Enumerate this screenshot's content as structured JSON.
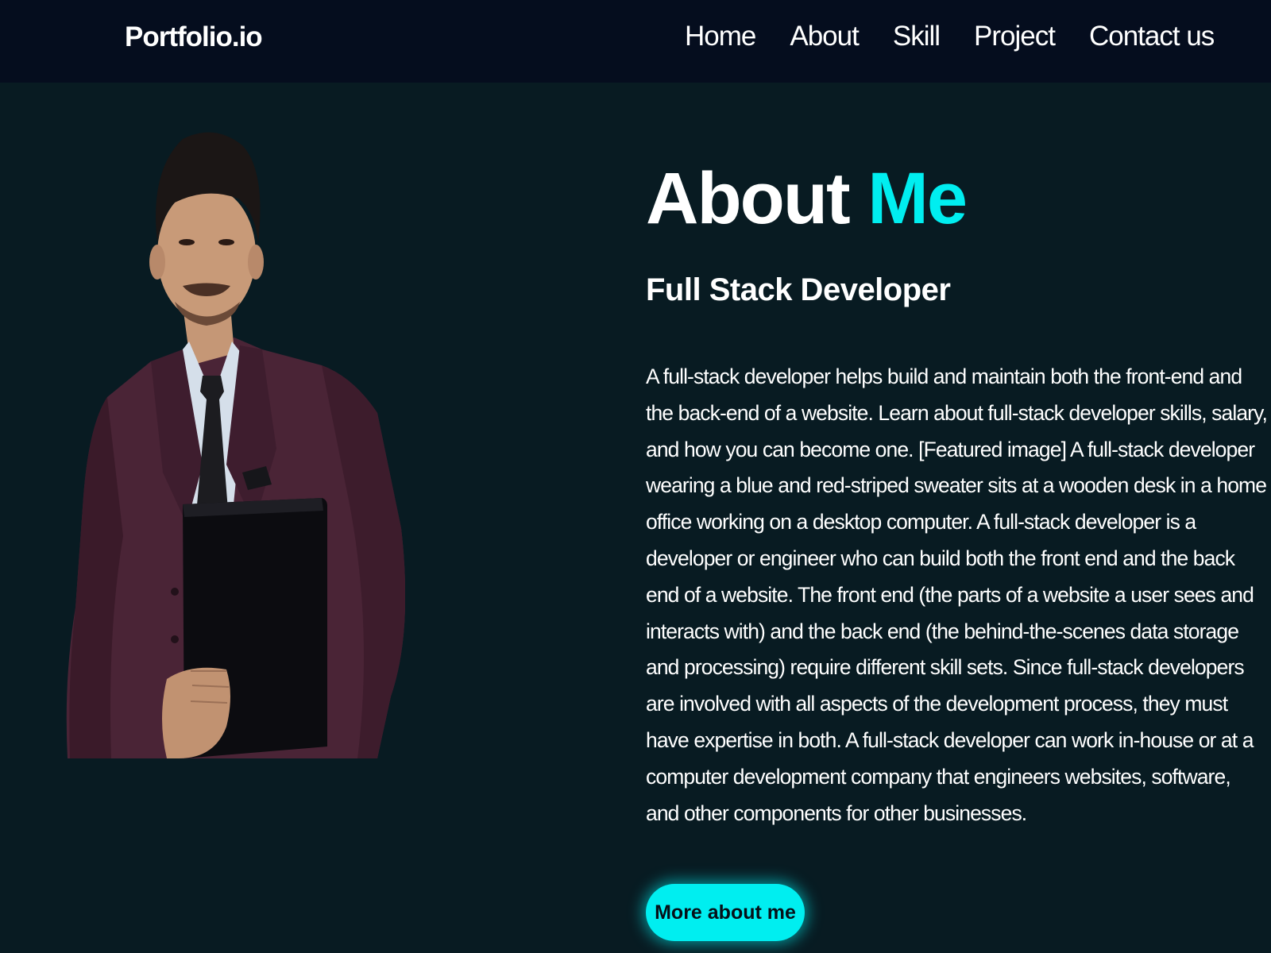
{
  "navbar": {
    "logo": "Portfolio.io",
    "links": [
      "Home",
      "About",
      "Skill",
      "Project",
      "Contact us"
    ]
  },
  "about": {
    "title_part1": "About ",
    "title_part2": "Me",
    "subtitle": "Full Stack Developer",
    "bio": "A full-stack developer helps build and maintain both the front-end and the back-end of a website. Learn about full-stack developer skills, salary, and how you can become one. [Featured image] A full-stack developer wearing a blue and red-striped sweater sits at a wooden desk in a home office working on a desktop computer. A full-stack developer is a developer or engineer who can build both the front end and the back end of a website. The front end (the parts of a website a user sees and interacts with) and the back end (the behind-the-scenes data storage and processing) require different skill sets. Since full-stack developers are involved with all aspects of the development process, they must have expertise in both. A full-stack developer can work in-house or at a computer development company that engineers websites, software, and other components for other businesses.",
    "button_label": "More about me"
  },
  "colors": {
    "accent": "#00eef0",
    "navbar_bg": "#050d1e",
    "page_bg": "#081b22",
    "suit": "#4a2436"
  }
}
